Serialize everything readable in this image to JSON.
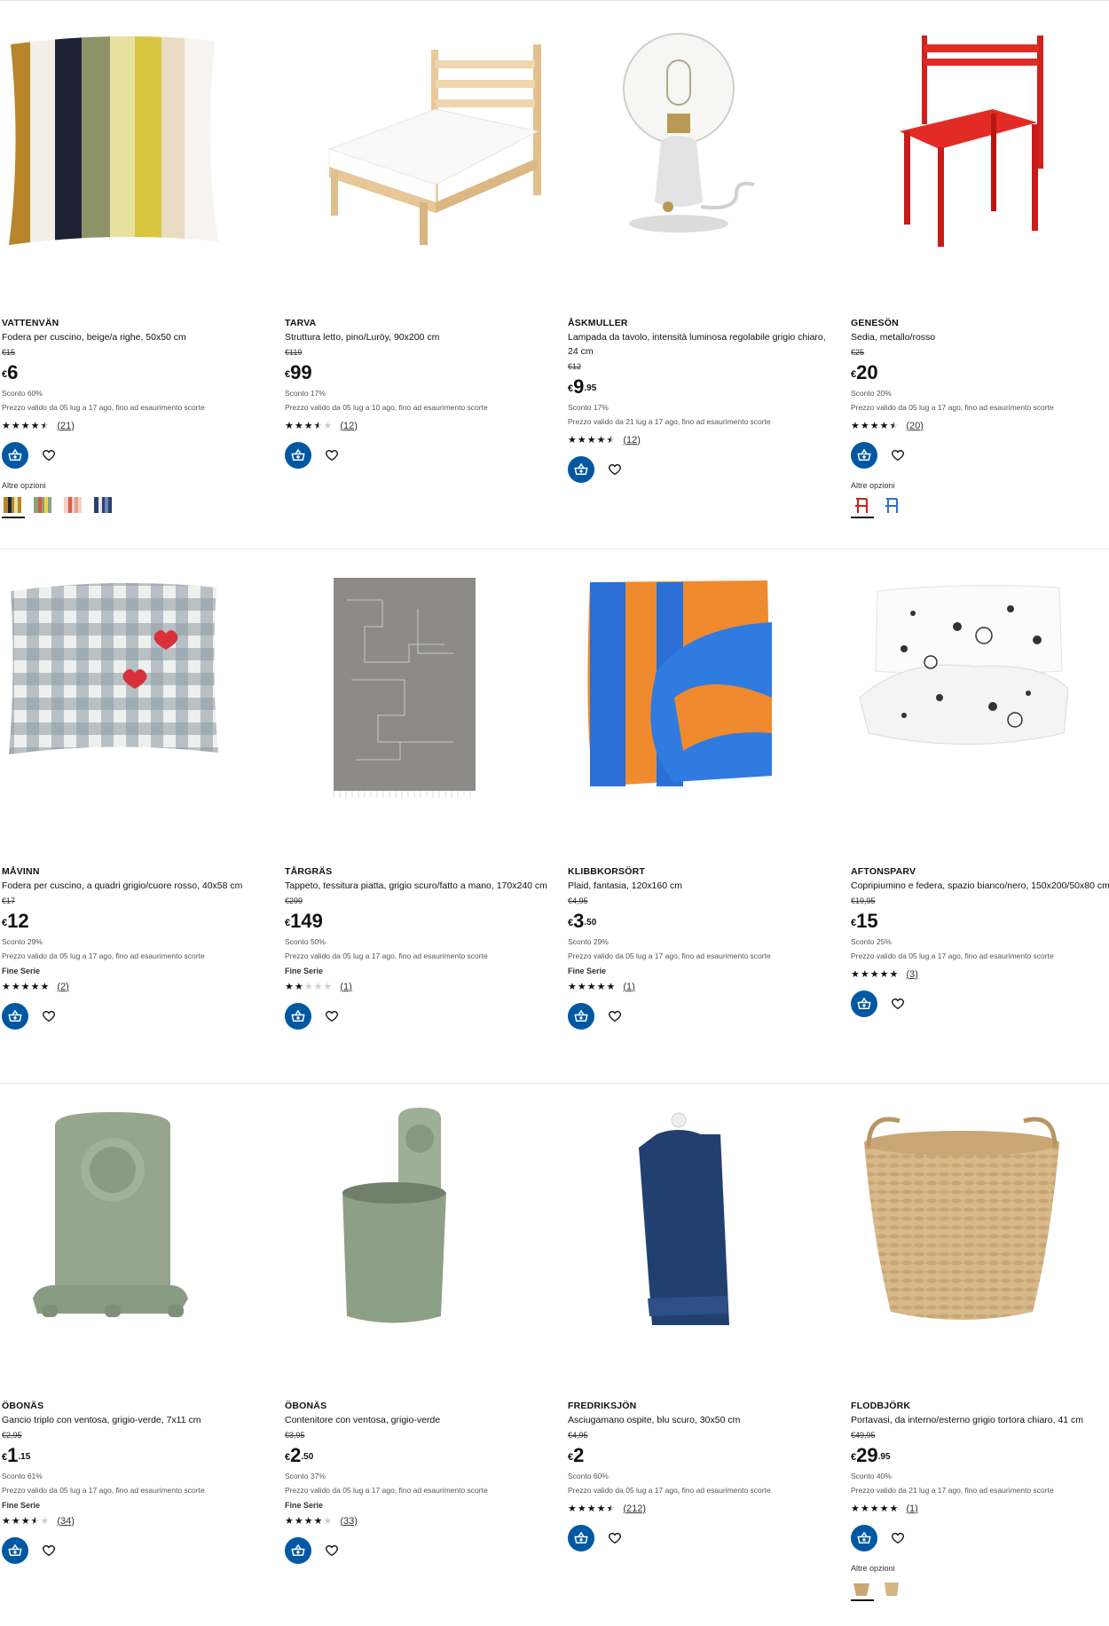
{
  "labels": {
    "altre_opzioni": "Altre opzioni"
  },
  "rows": [
    [
      {
        "name": "VATTENVÄN",
        "desc": "Fodera per cuscino, beige/a righe, 50x50 cm",
        "old": "€15",
        "cur": "€",
        "int": "6",
        "dec": "",
        "discount": "Sconto 60%",
        "valid": "Prezzo valido da 05 lug a 17 ago, fino ad esaurimento scorte",
        "badge": "",
        "stars": "4.5",
        "count": "(21)",
        "image": "striped-cushion",
        "options": [
          "stripe-a",
          "stripe-b",
          "stripe-c",
          "stripe-d"
        ]
      },
      {
        "name": "TARVA",
        "desc": "Struttura letto, pino/Luröy, 90x200 cm",
        "old": "€119",
        "cur": "€",
        "int": "99",
        "dec": "",
        "discount": "Sconto 17%",
        "valid": "Prezzo valido da 05 lug a 10 ago, fino ad esaurimento scorte",
        "badge": "",
        "stars": "3.5",
        "count": "(12)",
        "image": "pine-bed",
        "options": []
      },
      {
        "name": "ÅSKMULLER",
        "desc": "Lampada da tavolo, intensità luminosa regolabile grigio chiaro, 24 cm",
        "old": "€12",
        "cur": "€",
        "int": "9",
        "dec": ".95",
        "discount": "Sconto 17%",
        "valid": "Prezzo valido da 21 lug a 17 ago, fino ad esaurimento scorte",
        "badge": "",
        "stars": "4.5",
        "count": "(12)",
        "image": "table-lamp",
        "options": []
      },
      {
        "name": "GENESÖN",
        "desc": "Sedia, metallo/rosso",
        "old": "€25",
        "cur": "€",
        "int": "20",
        "dec": "",
        "discount": "Sconto 20%",
        "valid": "Prezzo valido da 05 lug a 17 ago, fino ad esaurimento scorte",
        "badge": "",
        "stars": "4.5",
        "count": "(20)",
        "image": "red-chair",
        "options": [
          "chair-red",
          "chair-blue"
        ]
      }
    ],
    [
      {
        "name": "MÅVINN",
        "desc": "Fodera per cuscino, a quadri grigio/cuore rosso, 40x58 cm",
        "old": "€17",
        "cur": "€",
        "int": "12",
        "dec": "",
        "discount": "Sconto 29%",
        "valid": "Prezzo valido da 05 lug a 17 ago, fino ad esaurimento scorte",
        "badge": "Fine Serie",
        "stars": "5",
        "count": "(2)",
        "image": "checked-cushion",
        "options": []
      },
      {
        "name": "TÅRGRÄS",
        "desc": "Tappeto, tessitura piatta, grigio scuro/fatto a mano, 170x240 cm",
        "old": "€299",
        "cur": "€",
        "int": "149",
        "dec": "",
        "discount": "Sconto 50%",
        "valid": "Prezzo valido da 05 lug a 17 ago, fino ad esaurimento scorte",
        "badge": "Fine Serie",
        "stars": "2",
        "count": "(1)",
        "image": "grey-rug",
        "options": []
      },
      {
        "name": "KLIBBKORSÖRT",
        "desc": "Plaid, fantasia, 120x160 cm",
        "old": "€4,95",
        "cur": "€",
        "int": "3",
        "dec": ".50",
        "discount": "Sconto 29%",
        "valid": "Prezzo valido da 05 lug a 17 ago, fino ad esaurimento scorte",
        "badge": "Fine Serie",
        "stars": "5",
        "count": "(1)",
        "image": "plaid-blanket",
        "options": []
      },
      {
        "name": "AFTONSPARV",
        "desc": "Copripiumino e federa, spazio bianco/nero, 150x200/50x80 cm",
        "old": "€19,95",
        "cur": "€",
        "int": "15",
        "dec": "",
        "discount": "Sconto 25%",
        "valid": "Prezzo valido da 05 lug a 17 ago, fino ad esaurimento scorte",
        "badge": "",
        "stars": "5",
        "count": "(3)",
        "image": "space-bedding",
        "options": []
      }
    ],
    [
      {
        "name": "ÖBONÄS",
        "desc": "Gancio triplo con ventosa, grigio-verde, 7x11 cm",
        "old": "€2,95",
        "cur": "€",
        "int": "1",
        "dec": ".15",
        "discount": "Sconto 61%",
        "valid": "Prezzo valido da 05 lug a 17 ago, fino ad esaurimento scorte",
        "badge": "Fine Serie",
        "stars": "3.5",
        "count": "(34)",
        "image": "triple-hook",
        "options": []
      },
      {
        "name": "ÖBONÄS",
        "desc": "Contenitore con ventosa, grigio-verde",
        "old": "€3,95",
        "cur": "€",
        "int": "2",
        "dec": ".50",
        "discount": "Sconto 37%",
        "valid": "Prezzo valido da 05 lug a 17 ago, fino ad esaurimento scorte",
        "badge": "Fine Serie",
        "stars": "4",
        "count": "(33)",
        "image": "suction-container",
        "options": []
      },
      {
        "name": "FREDRIKSJÖN",
        "desc": "Asciugamano ospite, blu scuro, 30x50 cm",
        "old": "€4,95",
        "cur": "€",
        "int": "2",
        "dec": "",
        "discount": "Sconto 60%",
        "valid": "Prezzo valido da 05 lug a 17 ago, fino ad esaurimento scorte",
        "badge": "",
        "stars": "4.5",
        "count": "(212)",
        "image": "blue-towel",
        "options": []
      },
      {
        "name": "FLODBJÖRK",
        "desc": "Portavasi, da interno/esterno grigio tortora chiaro, 41 cm",
        "old": "€49,95",
        "cur": "€",
        "int": "29",
        "dec": ".95",
        "discount": "Sconto 40%",
        "valid": "Prezzo valido da 21 lug a 17 ago, fino ad esaurimento scorte",
        "badge": "",
        "stars": "5",
        "count": "(1)",
        "image": "wicker-basket",
        "options": [
          "basket-a",
          "basket-b"
        ]
      }
    ]
  ]
}
